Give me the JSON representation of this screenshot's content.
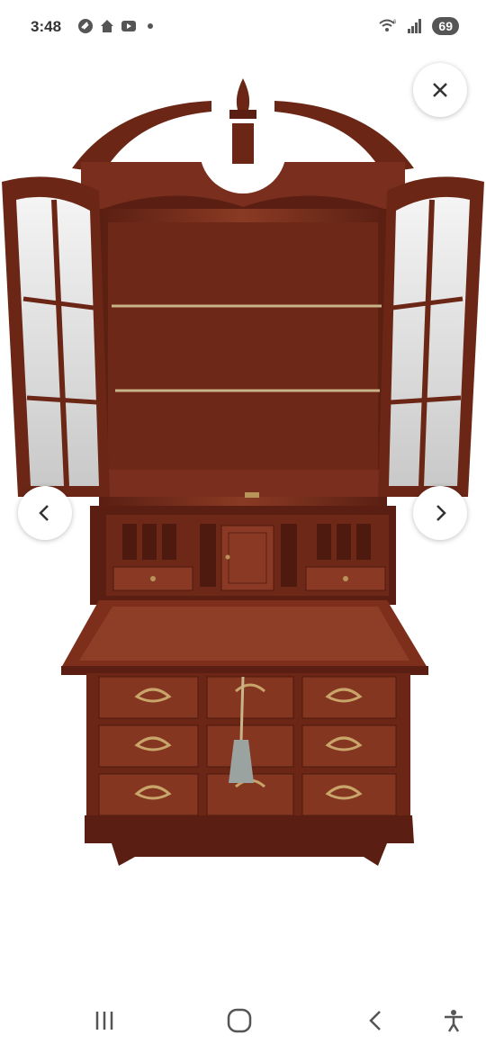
{
  "status_bar": {
    "time": "3:48",
    "icons": [
      "link-icon",
      "home-icon",
      "youtube-icon",
      "notification-dot"
    ],
    "right_icons": [
      "wifi-6-icon",
      "cellular-signal-icon"
    ],
    "battery": "69"
  },
  "viewer": {
    "image_subject": "cherry-wood-secretary-desk-photo",
    "close_icon": "close-icon",
    "prev_icon": "chevron-left-icon",
    "next_icon": "chevron-right-icon"
  },
  "system_nav": {
    "items": [
      "recent-apps-icon",
      "home-icon",
      "back-icon",
      "accessibility-icon"
    ]
  },
  "colors": {
    "wood": "#7a2e1e",
    "wood_dark": "#4e1a10",
    "wood_light": "#9a4a30",
    "brass": "#b8935a"
  }
}
